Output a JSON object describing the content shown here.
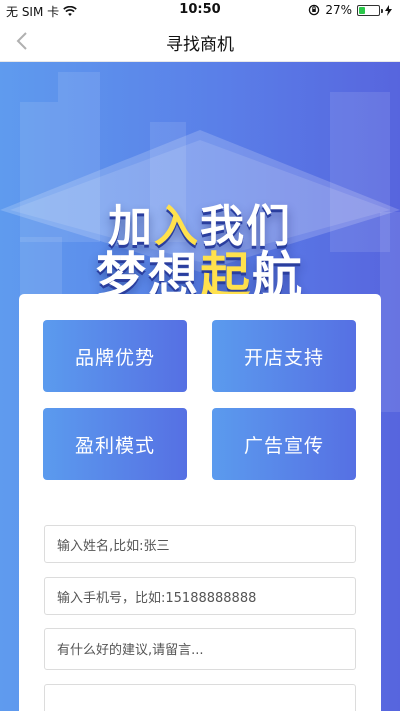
{
  "status_bar": {
    "carrier": "无 SIM 卡",
    "time": "10:50",
    "battery": "27%",
    "battery_level": 0.27
  },
  "nav": {
    "title": "寻找商机",
    "back_icon": "chevron-left-icon"
  },
  "hero": {
    "line1": {
      "before": "加",
      "accent": "入",
      "after": "我们"
    },
    "line2": {
      "before": "梦想",
      "accent": "起",
      "after": "航"
    }
  },
  "features": [
    "品牌优势",
    "开店支持",
    "盈利模式",
    "广告宣传"
  ],
  "form": {
    "name_placeholder": "输入姓名,比如:张三",
    "phone_placeholder": "输入手机号，比如:15188888888",
    "message_placeholder": "有什么好的建议,请留言..."
  },
  "colors": {
    "accent": "#5a7fe8",
    "slogan_highlight": "#ffe14d",
    "battery": "#2bc84b"
  }
}
